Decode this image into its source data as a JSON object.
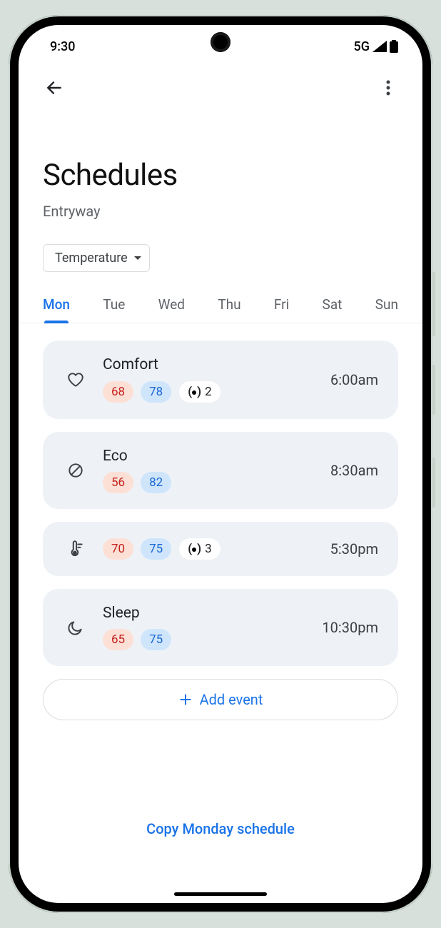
{
  "status": {
    "time": "9:30",
    "network": "5G"
  },
  "page": {
    "title": "Schedules",
    "subtitle": "Entryway"
  },
  "dropdown": {
    "label": "Temperature"
  },
  "tabs": [
    {
      "label": "Mon",
      "active": true
    },
    {
      "label": "Tue",
      "active": false
    },
    {
      "label": "Wed",
      "active": false
    },
    {
      "label": "Thu",
      "active": false
    },
    {
      "label": "Fri",
      "active": false
    },
    {
      "label": "Sat",
      "active": false
    },
    {
      "label": "Sun",
      "active": false
    }
  ],
  "events": [
    {
      "icon": "heart",
      "name": "Comfort",
      "heat": "68",
      "cool": "78",
      "sensors": "2",
      "time": "6:00am"
    },
    {
      "icon": "leaf",
      "name": "Eco",
      "heat": "56",
      "cool": "82",
      "sensors": null,
      "time": "8:30am"
    },
    {
      "icon": "thermo",
      "name": null,
      "heat": "70",
      "cool": "75",
      "sensors": "3",
      "time": "5:30pm"
    },
    {
      "icon": "moon",
      "name": "Sleep",
      "heat": "65",
      "cool": "75",
      "sensors": null,
      "time": "10:30pm"
    }
  ],
  "actions": {
    "add": "Add event",
    "copy": "Copy Monday schedule"
  }
}
